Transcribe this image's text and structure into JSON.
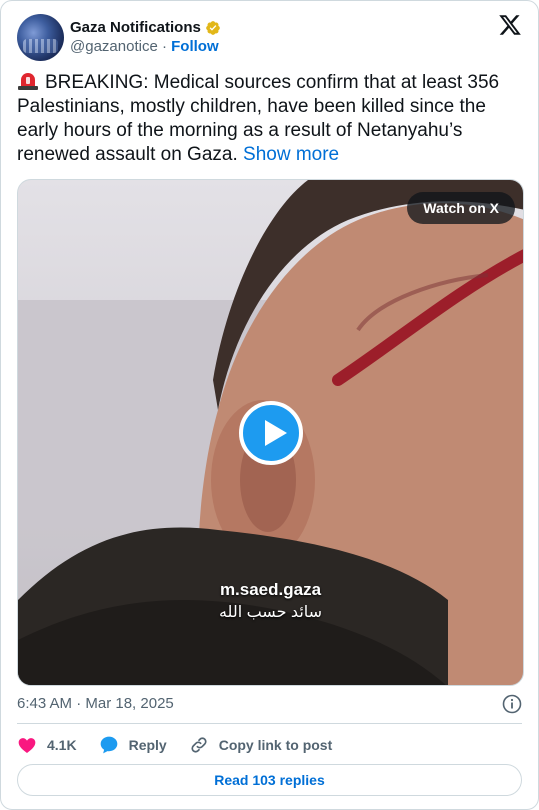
{
  "author": {
    "name": "Gaza Notifications",
    "handle": "@gazanotice",
    "separator": "·",
    "follow_label": "Follow"
  },
  "tweet": {
    "text": "BREAKING: Medical sources confirm that at least 356 Palestinians, mostly children, have been killed since the early hours of the morning as a result of Netanyahu’s renewed assault on Gaza.",
    "show_more": "Show more",
    "emoji": "rotating-light-icon"
  },
  "media": {
    "watch_label": "Watch on X",
    "watermark_line1": "m.saed.gaza",
    "watermark_line2": "سائد حسب الله"
  },
  "timestamp": "6:43 AM · Mar 18, 2025",
  "actions": {
    "likes": "4.1K",
    "reply_label": "Reply",
    "copy_label": "Copy link to post"
  },
  "read_replies": "Read 103 replies",
  "colors": {
    "link": "#006fd6",
    "like": "#f91880",
    "reply": "#1d9bf0",
    "verified": "#e2b719"
  }
}
